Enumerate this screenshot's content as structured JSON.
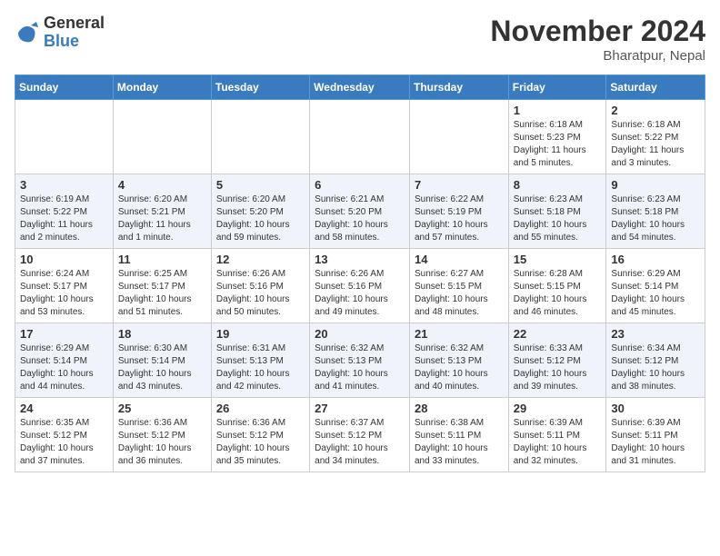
{
  "header": {
    "logo": {
      "general": "General",
      "blue": "Blue"
    },
    "month": "November 2024",
    "location": "Bharatpur, Nepal"
  },
  "days_of_week": [
    "Sunday",
    "Monday",
    "Tuesday",
    "Wednesday",
    "Thursday",
    "Friday",
    "Saturday"
  ],
  "weeks": [
    [
      {
        "day": null,
        "info": null
      },
      {
        "day": null,
        "info": null
      },
      {
        "day": null,
        "info": null
      },
      {
        "day": null,
        "info": null
      },
      {
        "day": null,
        "info": null
      },
      {
        "day": "1",
        "info": "Sunrise: 6:18 AM\nSunset: 5:23 PM\nDaylight: 11 hours\nand 5 minutes."
      },
      {
        "day": "2",
        "info": "Sunrise: 6:18 AM\nSunset: 5:22 PM\nDaylight: 11 hours\nand 3 minutes."
      }
    ],
    [
      {
        "day": "3",
        "info": "Sunrise: 6:19 AM\nSunset: 5:22 PM\nDaylight: 11 hours\nand 2 minutes."
      },
      {
        "day": "4",
        "info": "Sunrise: 6:20 AM\nSunset: 5:21 PM\nDaylight: 11 hours\nand 1 minute."
      },
      {
        "day": "5",
        "info": "Sunrise: 6:20 AM\nSunset: 5:20 PM\nDaylight: 10 hours\nand 59 minutes."
      },
      {
        "day": "6",
        "info": "Sunrise: 6:21 AM\nSunset: 5:20 PM\nDaylight: 10 hours\nand 58 minutes."
      },
      {
        "day": "7",
        "info": "Sunrise: 6:22 AM\nSunset: 5:19 PM\nDaylight: 10 hours\nand 57 minutes."
      },
      {
        "day": "8",
        "info": "Sunrise: 6:23 AM\nSunset: 5:18 PM\nDaylight: 10 hours\nand 55 minutes."
      },
      {
        "day": "9",
        "info": "Sunrise: 6:23 AM\nSunset: 5:18 PM\nDaylight: 10 hours\nand 54 minutes."
      }
    ],
    [
      {
        "day": "10",
        "info": "Sunrise: 6:24 AM\nSunset: 5:17 PM\nDaylight: 10 hours\nand 53 minutes."
      },
      {
        "day": "11",
        "info": "Sunrise: 6:25 AM\nSunset: 5:17 PM\nDaylight: 10 hours\nand 51 minutes."
      },
      {
        "day": "12",
        "info": "Sunrise: 6:26 AM\nSunset: 5:16 PM\nDaylight: 10 hours\nand 50 minutes."
      },
      {
        "day": "13",
        "info": "Sunrise: 6:26 AM\nSunset: 5:16 PM\nDaylight: 10 hours\nand 49 minutes."
      },
      {
        "day": "14",
        "info": "Sunrise: 6:27 AM\nSunset: 5:15 PM\nDaylight: 10 hours\nand 48 minutes."
      },
      {
        "day": "15",
        "info": "Sunrise: 6:28 AM\nSunset: 5:15 PM\nDaylight: 10 hours\nand 46 minutes."
      },
      {
        "day": "16",
        "info": "Sunrise: 6:29 AM\nSunset: 5:14 PM\nDaylight: 10 hours\nand 45 minutes."
      }
    ],
    [
      {
        "day": "17",
        "info": "Sunrise: 6:29 AM\nSunset: 5:14 PM\nDaylight: 10 hours\nand 44 minutes."
      },
      {
        "day": "18",
        "info": "Sunrise: 6:30 AM\nSunset: 5:14 PM\nDaylight: 10 hours\nand 43 minutes."
      },
      {
        "day": "19",
        "info": "Sunrise: 6:31 AM\nSunset: 5:13 PM\nDaylight: 10 hours\nand 42 minutes."
      },
      {
        "day": "20",
        "info": "Sunrise: 6:32 AM\nSunset: 5:13 PM\nDaylight: 10 hours\nand 41 minutes."
      },
      {
        "day": "21",
        "info": "Sunrise: 6:32 AM\nSunset: 5:13 PM\nDaylight: 10 hours\nand 40 minutes."
      },
      {
        "day": "22",
        "info": "Sunrise: 6:33 AM\nSunset: 5:12 PM\nDaylight: 10 hours\nand 39 minutes."
      },
      {
        "day": "23",
        "info": "Sunrise: 6:34 AM\nSunset: 5:12 PM\nDaylight: 10 hours\nand 38 minutes."
      }
    ],
    [
      {
        "day": "24",
        "info": "Sunrise: 6:35 AM\nSunset: 5:12 PM\nDaylight: 10 hours\nand 37 minutes."
      },
      {
        "day": "25",
        "info": "Sunrise: 6:36 AM\nSunset: 5:12 PM\nDaylight: 10 hours\nand 36 minutes."
      },
      {
        "day": "26",
        "info": "Sunrise: 6:36 AM\nSunset: 5:12 PM\nDaylight: 10 hours\nand 35 minutes."
      },
      {
        "day": "27",
        "info": "Sunrise: 6:37 AM\nSunset: 5:12 PM\nDaylight: 10 hours\nand 34 minutes."
      },
      {
        "day": "28",
        "info": "Sunrise: 6:38 AM\nSunset: 5:11 PM\nDaylight: 10 hours\nand 33 minutes."
      },
      {
        "day": "29",
        "info": "Sunrise: 6:39 AM\nSunset: 5:11 PM\nDaylight: 10 hours\nand 32 minutes."
      },
      {
        "day": "30",
        "info": "Sunrise: 6:39 AM\nSunset: 5:11 PM\nDaylight: 10 hours\nand 31 minutes."
      }
    ]
  ]
}
